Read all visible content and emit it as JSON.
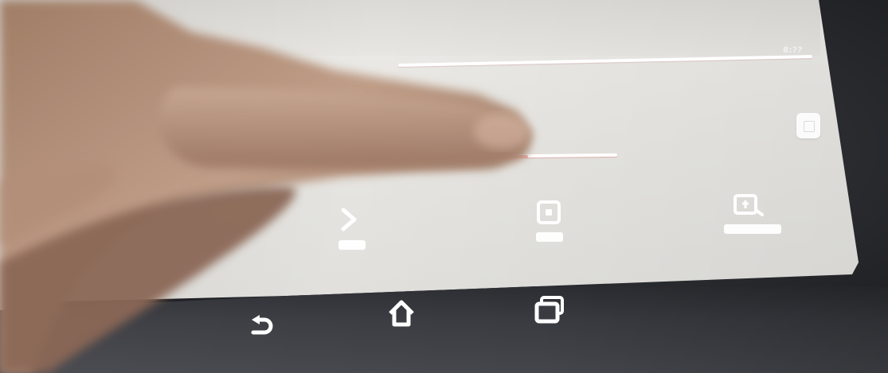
{
  "status_bar": {
    "time_text": "8:??"
  },
  "settings_screen": {
    "slider_level": 0.48,
    "actions": [
      {
        "icon": "wifi-icon",
        "state": "inactive"
      },
      {
        "icon": "screenshot-icon",
        "state": "inactive"
      },
      {
        "icon": "screen-record-icon",
        "state": "inactive"
      }
    ]
  },
  "navigation_bar": {
    "buttons": [
      {
        "icon": "back-icon"
      },
      {
        "icon": "home-icon"
      },
      {
        "icon": "recent-apps-icon"
      }
    ]
  },
  "colors": {
    "screen_background": "#e6e5e1",
    "navbar_background": "#3a3b41",
    "slider_fill": "#e6a39a",
    "icon_color": "#ffffff"
  }
}
